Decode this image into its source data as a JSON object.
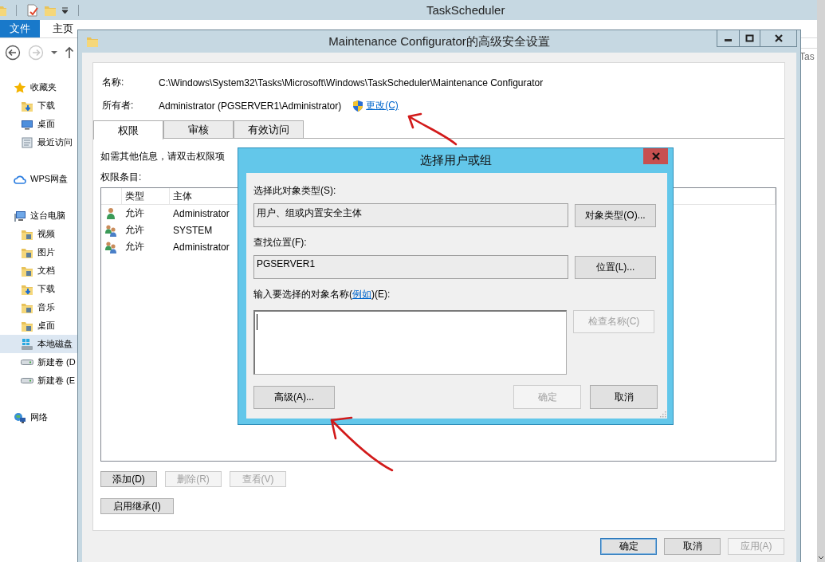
{
  "explorer": {
    "title": "TaskScheduler",
    "file_tab": "文件",
    "tabs": [
      "主页"
    ],
    "field_text": "Tas",
    "nav": [
      {
        "kind": "star",
        "label": "收藏夹",
        "selected": false,
        "children": [
          {
            "kind": "download",
            "label": "下载",
            "selected": false
          },
          {
            "kind": "desktop",
            "label": "桌面",
            "selected": false
          },
          {
            "kind": "recent",
            "label": "最近访问",
            "selected": false
          }
        ]
      },
      {
        "kind": "cloud",
        "label": "WPS网盘",
        "selected": false
      },
      {
        "kind": "computer",
        "label": "这台电脑",
        "selected": false,
        "children": [
          {
            "kind": "folder",
            "label": "视频",
            "selected": false
          },
          {
            "kind": "folder",
            "label": "图片",
            "selected": false
          },
          {
            "kind": "folder",
            "label": "文档",
            "selected": false
          },
          {
            "kind": "download",
            "label": "下载",
            "selected": false
          },
          {
            "kind": "folder",
            "label": "音乐",
            "selected": false
          },
          {
            "kind": "folder",
            "label": "桌面",
            "selected": false
          },
          {
            "kind": "system-drive",
            "label": "本地磁盘",
            "selected": true
          },
          {
            "kind": "drive",
            "label": "新建卷 (D",
            "selected": false
          },
          {
            "kind": "drive",
            "label": "新建卷 (E",
            "selected": false
          }
        ]
      },
      {
        "kind": "network",
        "label": "网络",
        "selected": false
      }
    ]
  },
  "security_dialog": {
    "title": "Maintenance Configurator的高级安全设置",
    "name_label": "名称:",
    "name_value": "C:\\Windows\\System32\\Tasks\\Microsoft\\Windows\\TaskScheduler\\Maintenance Configurator",
    "owner_label": "所有者:",
    "owner_value": "Administrator (PGSERVER1\\Administrator)",
    "change_link": "更改(C)",
    "tabs": [
      {
        "label": "权限",
        "selected": true
      },
      {
        "label": "审核",
        "selected": false
      },
      {
        "label": "有效访问",
        "selected": false
      }
    ],
    "hint": "如需其他信息，请双击权限项",
    "entries_label": "权限条目:",
    "table": {
      "columns": [
        "类型",
        "主体"
      ],
      "rows": [
        {
          "kind": "user",
          "type": "允许",
          "principal": "Administrator"
        },
        {
          "kind": "group",
          "type": "允许",
          "principal": "SYSTEM"
        },
        {
          "kind": "group",
          "type": "允许",
          "principal": "Administrator"
        }
      ]
    },
    "buttons": [
      {
        "label": "添加(D)",
        "disabled": false
      },
      {
        "label": "删除(R)",
        "disabled": true
      },
      {
        "label": "查看(V)",
        "disabled": true
      }
    ],
    "inherit_button": "启用继承(I)",
    "footer_buttons": [
      {
        "label": "确定",
        "disabled": false,
        "default": true
      },
      {
        "label": "取消",
        "disabled": false,
        "default": false
      },
      {
        "label": "应用(A)",
        "disabled": true,
        "default": false
      }
    ]
  },
  "select_dialog": {
    "title": "选择用户或组",
    "object_type_label": "选择此对象类型(S):",
    "object_type_value": "用户、组或内置安全主体",
    "object_type_button": "对象类型(O)...",
    "location_label": "查找位置(F):",
    "location_value": "PGSERVER1",
    "location_button": "位置(L)...",
    "names_label_before": "输入要选择的对象名称(",
    "names_label_link": "例如",
    "names_label_after": ")(E):",
    "check_names_button": {
      "label": "检查名称(C)",
      "disabled": true
    },
    "advanced_button": "高级(A)...",
    "ok_button": {
      "label": "确定",
      "disabled": true
    },
    "cancel_button": {
      "label": "取消",
      "disabled": false
    }
  }
}
